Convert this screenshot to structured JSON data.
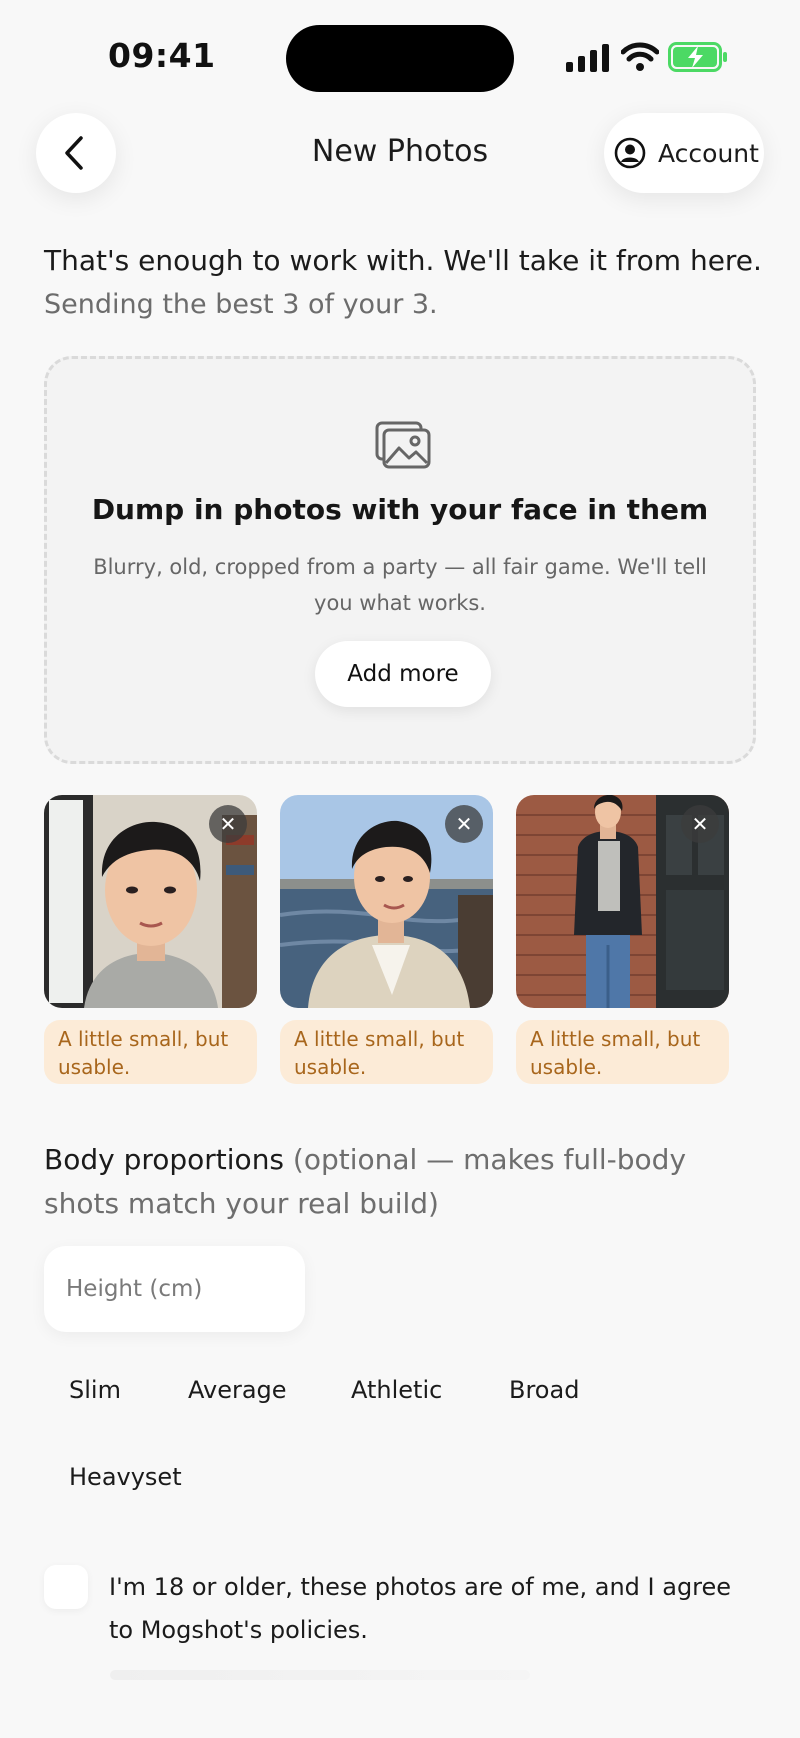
{
  "status_bar": {
    "time": "09:41",
    "battery_color": "#4cd964",
    "icons": [
      "cellular-signal-icon",
      "wifi-icon",
      "battery-charging-icon"
    ]
  },
  "nav": {
    "back_icon": "chevron-left-icon",
    "title": "New Photos",
    "account_icon": "user-circle-icon",
    "account_label": "Account"
  },
  "intro": {
    "headline": "That's enough to work with. We'll take it from here.",
    "subline": "Sending the best 3 of your 3."
  },
  "dropzone": {
    "icon": "images-icon",
    "title": "Dump in photos with your face in them",
    "text": "Blurry, old, cropped from a party — all fair game. We'll tell you what works.",
    "button_label": "Add more"
  },
  "photos": [
    {
      "remove_label": "✕",
      "status": "A little small, but usable.",
      "status_color": "#a8661c"
    },
    {
      "remove_label": "✕",
      "status": "A little small, but usable.",
      "status_color": "#a8661c"
    },
    {
      "remove_label": "✕",
      "status": "A little small, but usable.",
      "status_color": "#a8661c"
    }
  ],
  "body": {
    "title": "Body proportions",
    "title_hint": " (optional — makes full-body shots match your real build)",
    "height_placeholder": "Height (cm)",
    "build_options": [
      "Slim",
      "Average",
      "Athletic",
      "Broad",
      "Heavyset"
    ]
  },
  "consent": {
    "text": "I'm 18 or older, these photos are of me, and I agree to Mogshot's policies."
  }
}
